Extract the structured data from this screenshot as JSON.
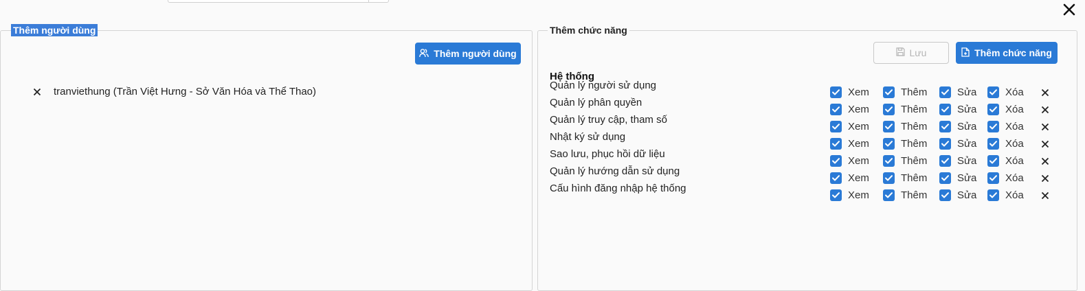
{
  "dialog": {
    "close_icon": "close-icon"
  },
  "left_panel": {
    "legend": "Thêm người dùng",
    "add_user_button": {
      "label": "Thêm người dùng",
      "icon": "users-icon"
    },
    "users": [
      {
        "label": "tranviethung (Trần Việt Hưng - Sở Văn Hóa và Thể Thao)"
      }
    ]
  },
  "right_panel": {
    "legend": "Thêm chức năng",
    "save_button": {
      "label": "Lưu",
      "icon": "save-icon",
      "disabled": true
    },
    "add_function_button": {
      "label": "Thêm chức năng",
      "icon": "file-add-icon"
    },
    "group_title": "Hệ thống",
    "permission_labels": {
      "view": "Xem",
      "add": "Thêm",
      "edit": "Sửa",
      "delete": "Xóa"
    },
    "functions": [
      {
        "name": "Quản lý người sử dụng",
        "view": true,
        "add": true,
        "edit": true,
        "delete": true
      },
      {
        "name": "Quản lý phân quyền",
        "view": true,
        "add": true,
        "edit": true,
        "delete": true
      },
      {
        "name": "Quản lý truy cập, tham số",
        "view": true,
        "add": true,
        "edit": true,
        "delete": true
      },
      {
        "name": "Nhật ký sử dụng",
        "view": true,
        "add": true,
        "edit": true,
        "delete": true
      },
      {
        "name": "Sao lưu, phục hồi dữ liệu",
        "view": true,
        "add": true,
        "edit": true,
        "delete": true
      },
      {
        "name": "Quản lý hướng dẫn sử dụng",
        "view": true,
        "add": true,
        "edit": true,
        "delete": true
      },
      {
        "name": "Cấu hình đăng nhập hệ thống",
        "view": true,
        "add": true,
        "edit": true,
        "delete": true
      }
    ]
  },
  "colors": {
    "primary": "#2a7ad6",
    "legend_highlight": "#3b7dd8",
    "border": "#d4d4d4"
  }
}
